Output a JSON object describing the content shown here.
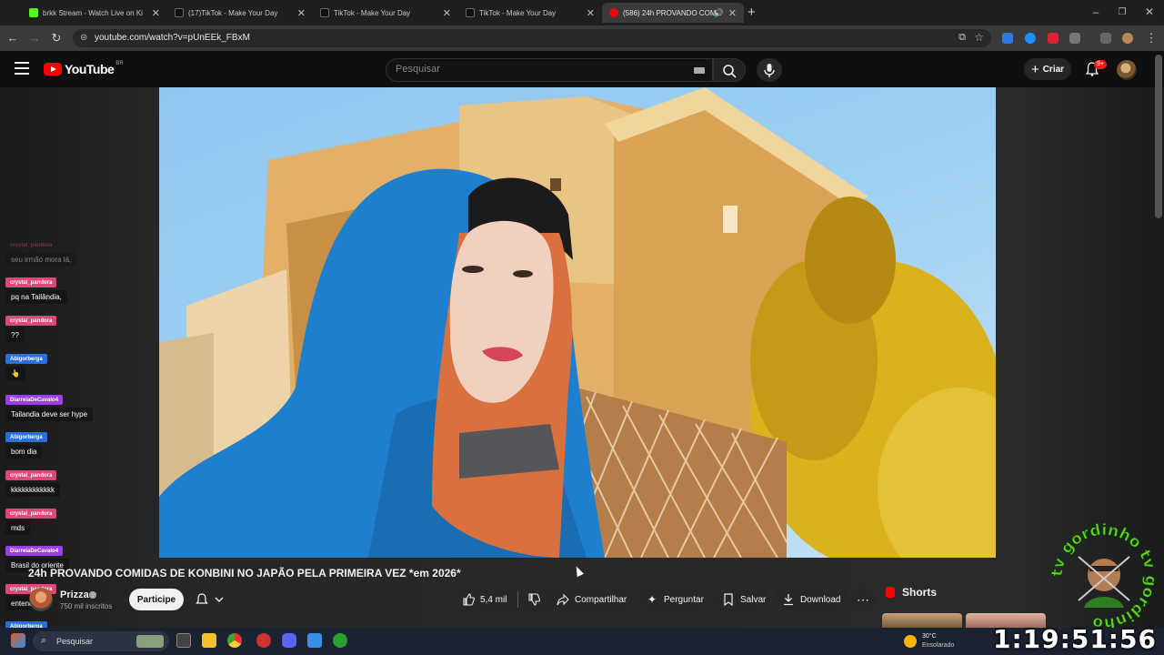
{
  "browser": {
    "tabs": [
      {
        "title": "brkk Stream - Watch Live on Ki",
        "favicon_color": "#53fc18"
      },
      {
        "title": "(17)TikTok - Make Your Day",
        "favicon_color": "#111111"
      },
      {
        "title": "TikTok - Make Your Day",
        "favicon_color": "#111111"
      },
      {
        "title": "TikTok - Make Your Day",
        "favicon_color": "#111111"
      },
      {
        "title": "(586) 24h PROVANDO COM",
        "favicon_color": "#ff0000"
      }
    ],
    "url": "youtube.com/watch?v=pUnEEk_FBxM"
  },
  "youtube": {
    "logo_text": "YouTube",
    "region": "BR",
    "search_placeholder": "Pesquisar",
    "create_label": "Criar",
    "notification_count": "9+"
  },
  "chat": [
    {
      "user": "crystal_pandora",
      "text": "seu irmão mora lá,",
      "color": "#e0457b"
    },
    {
      "user": "crystal_pandora",
      "text": "pq na Tailândia,",
      "color": "#e0457b"
    },
    {
      "user": "crystal_pandora",
      "text": "??",
      "color": "#e0457b"
    },
    {
      "user": "Abigorberga",
      "text": "👆",
      "color": "#2a6ee0"
    },
    {
      "user": "DiarreiaDeCavalo4",
      "text": "Tailandia deve ser hype",
      "color": "#9b3ee8"
    },
    {
      "user": "Abigorberga",
      "text": "bom dia",
      "color": "#2a6ee0"
    },
    {
      "user": "crystal_pandora",
      "text": "kkkkkkkkkkkk",
      "color": "#e0457b"
    },
    {
      "user": "crystal_pandora",
      "text": "mds",
      "color": "#e0457b"
    },
    {
      "user": "DiarreiaDeCavalo4",
      "text": "Brasil do oriente",
      "color": "#9b3ee8"
    },
    {
      "user": "crystal_pandora",
      "text": "entendi",
      "color": "#e0457b"
    },
    {
      "user": "Abigorberga",
      "text": "",
      "color": "#2a6ee0"
    }
  ],
  "video": {
    "title": "24h PROVANDO COMIDAS DE KONBINI NO JAPÃO PELA PRIMEIRA VEZ *em 2026*",
    "channel": "Prizza",
    "subscribers": "750 mil inscritos",
    "join_label": "Participe",
    "likes": "5,4 mil",
    "share_label": "Compartilhar",
    "ask_label": "Perguntar",
    "save_label": "Salvar",
    "download_label": "Download",
    "shorts_label": "Shorts"
  },
  "watermark_text": "tv gordinho tv gordinho",
  "taskbar": {
    "search_placeholder": "Pesquisar",
    "weather_temp": "30°C",
    "weather_condition": "Ensolarado",
    "clock": "1:19:51:56"
  }
}
